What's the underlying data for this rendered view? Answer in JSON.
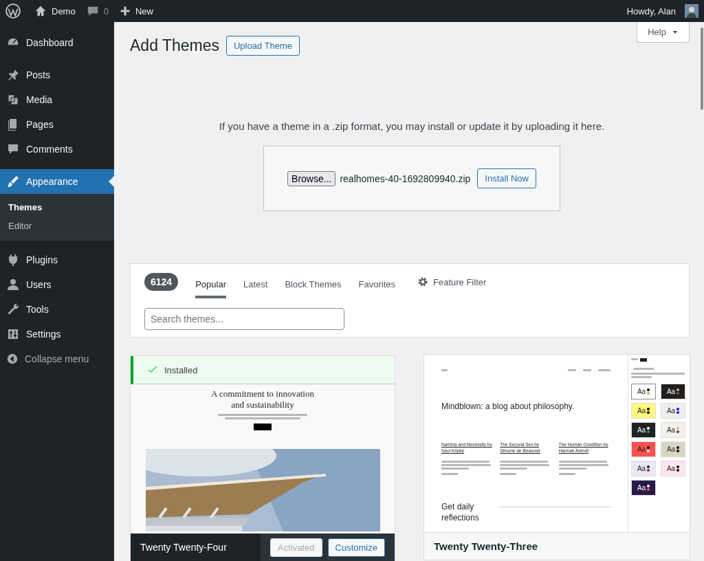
{
  "admin_bar": {
    "site": "Demo",
    "comments_count": "0",
    "new": "New",
    "greeting": "Howdy, Alan"
  },
  "sidebar": {
    "items": [
      {
        "label": "Dashboard",
        "kind": "dashboard",
        "selected": false
      },
      {
        "label": "Posts",
        "kind": "posts",
        "selected": false
      },
      {
        "label": "Media",
        "kind": "media",
        "selected": false
      },
      {
        "label": "Pages",
        "kind": "pages",
        "selected": false
      },
      {
        "label": "Comments",
        "kind": "comments",
        "selected": false
      },
      {
        "label": "Appearance",
        "kind": "appearance",
        "selected": true,
        "children": [
          {
            "label": "Themes",
            "selected": true
          },
          {
            "label": "Editor",
            "selected": false
          }
        ]
      },
      {
        "label": "Plugins",
        "kind": "plugins",
        "selected": false
      },
      {
        "label": "Users",
        "kind": "users",
        "selected": false
      },
      {
        "label": "Tools",
        "kind": "tools",
        "selected": false
      },
      {
        "label": "Settings",
        "kind": "settings",
        "selected": false
      }
    ],
    "collapse": "Collapse menu"
  },
  "page": {
    "title": "Add Themes",
    "upload_button": "Upload Theme",
    "help": "Help"
  },
  "upload": {
    "instructions": "If you have a theme in a .zip format, you may install or update it by uploading it here.",
    "browse": "Browse...",
    "file_name": "realhomes-40-1692809940.zip",
    "install": "Install Now"
  },
  "filter_bar": {
    "count": "6124",
    "tabs": [
      {
        "label": "Popular",
        "selected": true
      },
      {
        "label": "Latest",
        "selected": false
      },
      {
        "label": "Block Themes",
        "selected": false
      },
      {
        "label": "Favorites",
        "selected": false
      }
    ],
    "feature_filter": "Feature Filter",
    "search_placeholder": "Search themes..."
  },
  "themes": [
    {
      "name": "Twenty Twenty-Four",
      "active": true,
      "notice": "Installed",
      "actions": [
        {
          "label": "Activated",
          "disabled": true
        },
        {
          "label": "Customize",
          "disabled": false
        }
      ],
      "preview": {
        "kind": "hero",
        "heading": "A commitment to innovation and sustainability"
      }
    },
    {
      "name": "Twenty Twenty-Three",
      "active": false,
      "preview": {
        "kind": "blog",
        "heading": "Mindblown: a blog about philosophy.",
        "posts": [
          {
            "title": "Naming and Necessity by Saul Kripke"
          },
          {
            "title": "The Second Sex by Simone de Beauvoir"
          },
          {
            "title": "The Human Condition by Hannah Arendt"
          }
        ],
        "signup": "Get daily reflections",
        "panel": {
          "swatches": [
            {
              "label": "Aa",
              "color": "#ffffff",
              "selected": true,
              "dots": [
                {
                  "color": "#000000"
                },
                {
                  "color": "#7ed321"
                }
              ]
            },
            {
              "label": "Aa",
              "color": "#1f1f1f",
              "selected": false,
              "dots": [
                {
                  "color": "#d0b090"
                },
                {
                  "color": "#7a5a30"
                }
              ]
            },
            {
              "label": "Aa",
              "color": "#fbfa7e",
              "selected": false,
              "dots": [
                {
                  "color": "#000000"
                },
                {
                  "color": "#000000"
                }
              ]
            },
            {
              "label": "Aa",
              "color": "#eeeeee",
              "selected": false,
              "dots": [
                {
                  "color": "#3300ff"
                },
                {
                  "color": "#3300ff"
                }
              ]
            },
            {
              "label": "Aa",
              "color": "#1f2326",
              "selected": false,
              "dots": [
                {
                  "color": "#ffffff"
                },
                {
                  "color": "#1fa340"
                }
              ]
            },
            {
              "label": "Aa",
              "color": "#f2f0ea",
              "selected": false,
              "dots": [
                {
                  "color": "#e0b070"
                },
                {
                  "color": "#444444"
                }
              ]
            },
            {
              "label": "Aa",
              "color": "#ff524f",
              "selected": false,
              "dots": [
                {
                  "color": "#000000"
                },
                {
                  "color": "#ffffff"
                }
              ]
            },
            {
              "label": "Aa",
              "color": "#d8d6c2",
              "selected": false,
              "dots": [
                {
                  "color": "#000000"
                },
                {
                  "color": "#000000"
                }
              ]
            },
            {
              "label": "Aa",
              "color": "#e6e8f2",
              "selected": false,
              "dots": [
                {
                  "color": "#1a1a2e"
                },
                {
                  "color": "#a0283a"
                }
              ]
            },
            {
              "label": "Aa",
              "color": "#fbe6ef",
              "selected": false,
              "dots": [
                {
                  "color": "#000000"
                },
                {
                  "color": "#000000"
                }
              ]
            },
            {
              "label": "Aa",
              "color": "#2a1a4a",
              "selected": false,
              "dots": [
                {
                  "color": "#ffffff"
                },
                {
                  "color": "#ff5a3c"
                }
              ]
            }
          ]
        }
      }
    }
  ]
}
